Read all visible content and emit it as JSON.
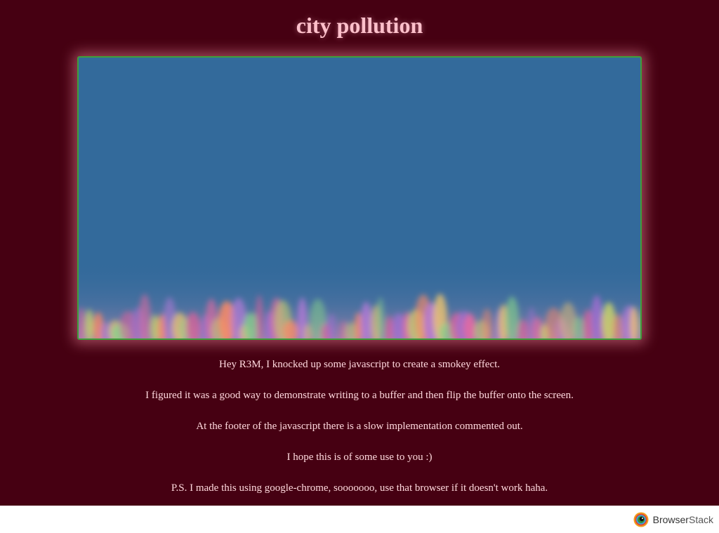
{
  "page": {
    "title": "city pollution"
  },
  "messages": [
    "Hey R3M, I knocked up some javascript to create a smokey effect.",
    "I figured it was a good way to demonstrate writing to a buffer and then flip the buffer onto the screen.",
    "At the footer of the javascript there is a slow implementation commented out.",
    "I hope this is of some use to you :)",
    "P.S. I made this using google-chrome, sooooooo, use that browser if it doesn't work haha."
  ],
  "footer": {
    "brand_part1": "Browser",
    "brand_part2": "Stack",
    "logo_icon": "browserstack-eye-icon"
  },
  "colors": {
    "page_background": "#460012",
    "title_color": "#ffc0cb",
    "canvas_sky": "#336a9b",
    "canvas_border": "#3f9f3a"
  }
}
